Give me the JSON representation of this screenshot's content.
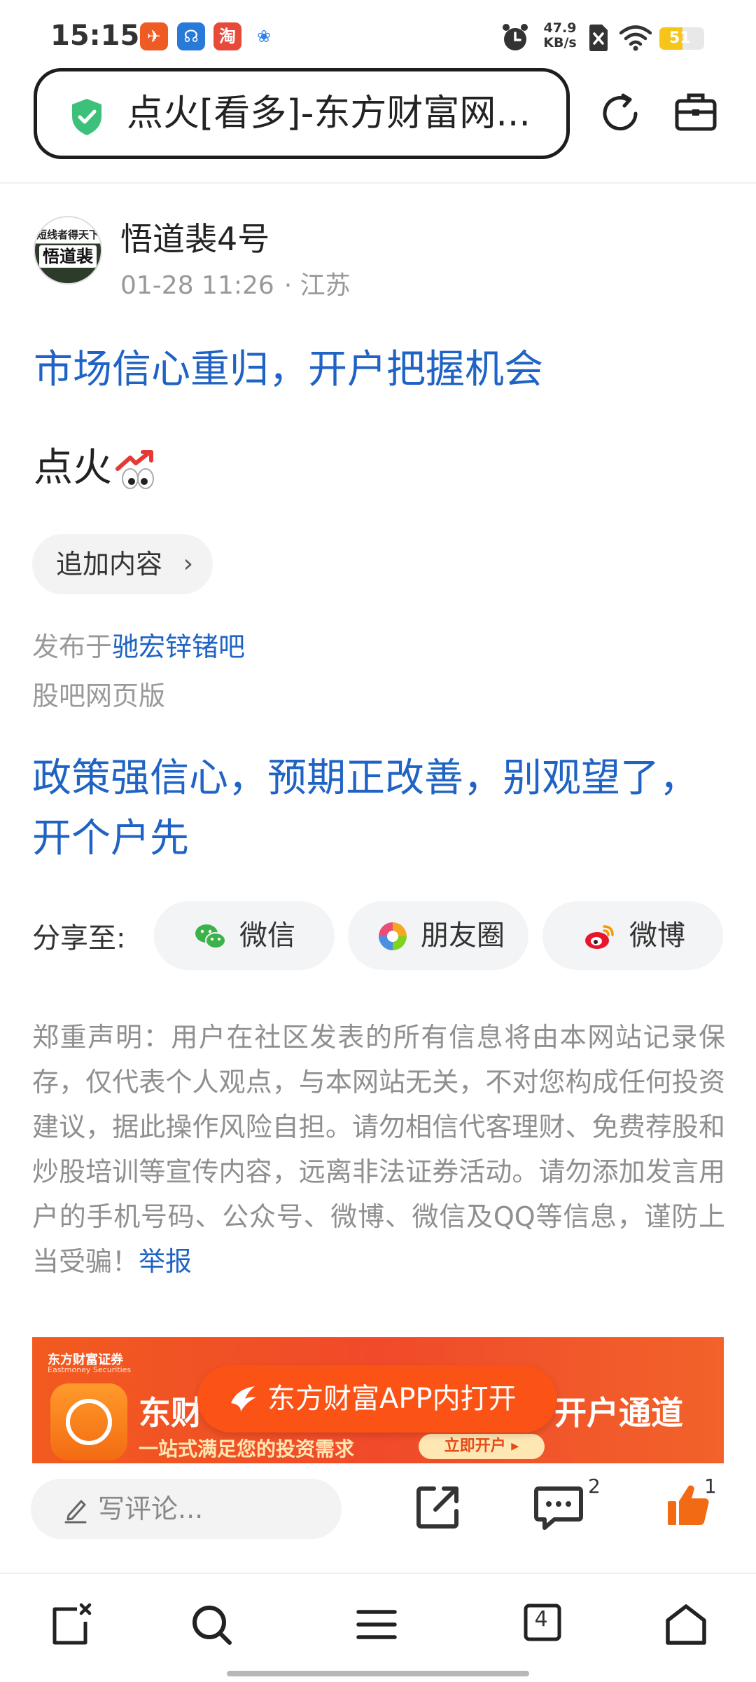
{
  "status_bar": {
    "time": "15:15",
    "net_speed_value": "47.9",
    "net_speed_unit": "KB/s",
    "battery": "51",
    "battery_level": 0.51,
    "icons": [
      "app-notification-icon",
      "app-notification-icon",
      "app-notification-icon",
      "app-notification-icon",
      "alarm-icon",
      "no-sim-icon",
      "wifi-icon",
      "battery-icon"
    ]
  },
  "browser": {
    "url_title": "点火[看多]-东方财富网...",
    "icons": [
      "shield-check-icon",
      "reload-icon",
      "toolbox-icon"
    ]
  },
  "post": {
    "author": "悟道裴4号",
    "avatar_top_text": "短线者得天下",
    "avatar_main_text": "悟道裴",
    "date": "01-28 11:26",
    "location": "· 江苏",
    "title": "市场信心重归，开户把握机会",
    "body": "点火",
    "append_label": "追加内容",
    "published_prefix": "发布于",
    "published_bar": "驰宏锌锗吧",
    "web_version": "股吧网页版"
  },
  "promo": {
    "text": "政策强信心，预期正改善，别观望了，开个户先"
  },
  "share": {
    "label": "分享至:",
    "wechat": "微信",
    "moments": "朋友圈",
    "weibo": "微博"
  },
  "disclaimer": {
    "text": "郑重声明：用户在社区发表的所有信息将由本网站记录保存，仅代表个人观点，与本网站无关，不对您构成任何投资建议，据此操作风险自担。请勿相信代客理财、免费荐股和炒股培训等宣传内容，远离非法证券活动。请勿添加发言用户的手机号码、公众号、微博、微信及QQ等信息，谨防上当受骗！",
    "report": "举报"
  },
  "banner": {
    "brand": "东方财富证券",
    "brand_en": "Eastmoney Securities",
    "big_left": "东财",
    "big_right": "开户通道",
    "tagline": "一站式满足您的投资需求",
    "cta": "立即开户 ▸",
    "open_app": "东方财富APP内打开"
  },
  "comment_bar": {
    "placeholder": "写评论...",
    "comment_count": "2",
    "like_count": "1"
  },
  "nav": {
    "tabs_count": "4"
  },
  "colors": {
    "link_blue": "#1f63c4",
    "brand_orange": "#fb5215",
    "shield_green": "#3cc07a"
  }
}
